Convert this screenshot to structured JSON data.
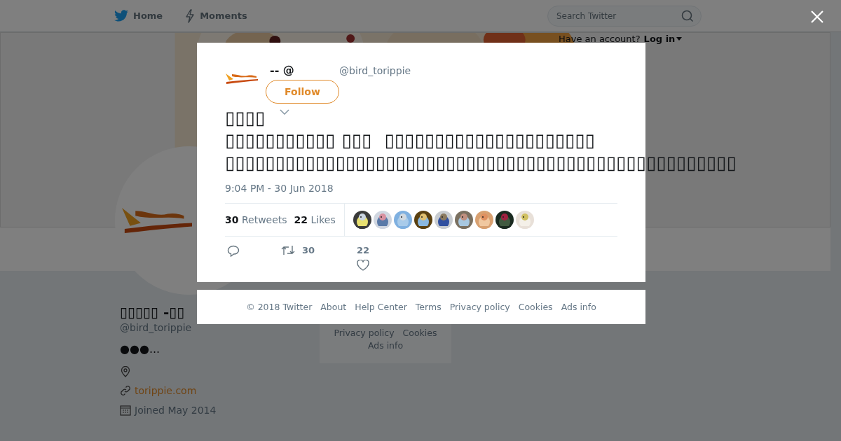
{
  "nav": {
    "items": [
      {
        "kind": "home",
        "label": "Home"
      },
      {
        "kind": "moments",
        "label": "Moments"
      }
    ],
    "search": {
      "placeholder": "Search Twitter"
    }
  },
  "login_prompt": {
    "text": "Have an account?",
    "link": "Log in"
  },
  "profile": {
    "name": "▯▯▯▯▯ -▯▯",
    "handle": "@bird_torippie",
    "bio": "●●●...",
    "website": "torippie.com",
    "joined": "Joined May 2014"
  },
  "background_footer": {
    "links": [
      "Privacy policy",
      "Cookies",
      "Ads info"
    ]
  },
  "tweet": {
    "name": "-- @",
    "handle": "@bird_torippie",
    "follow_button": "Follow",
    "text_lines": [
      "▯▯▯▯",
      "▯▯▯▯▯▯▯▯▯▯▯ ▯▯▯  ▯▯▯▯▯▯▯▯▯▯▯▯▯▯▯▯▯▯▯▯▯",
      "▯▯▯▯▯▯▯▯▯▯▯▯▯▯▯▯▯▯▯▯▯▯▯▯▯▯▯▯▯▯▯▯▯▯▯▯▯▯▯▯▯▯▯▯▯▯▯▯▯▯▯"
    ],
    "timestamp": "9:04 PM - 30 Jun 2018",
    "retweets": {
      "count": "30",
      "label": "Retweets"
    },
    "likes": {
      "count": "22",
      "label": "Likes"
    },
    "actions": [
      {
        "kind": "reply"
      },
      {
        "kind": "retweet",
        "count": "30"
      },
      {
        "kind": "like",
        "count": "22"
      }
    ]
  },
  "footer": {
    "links": [
      "© 2018 Twitter",
      "About",
      "Help Center",
      "Terms",
      "Privacy policy",
      "Cookies",
      "Ads info"
    ]
  }
}
